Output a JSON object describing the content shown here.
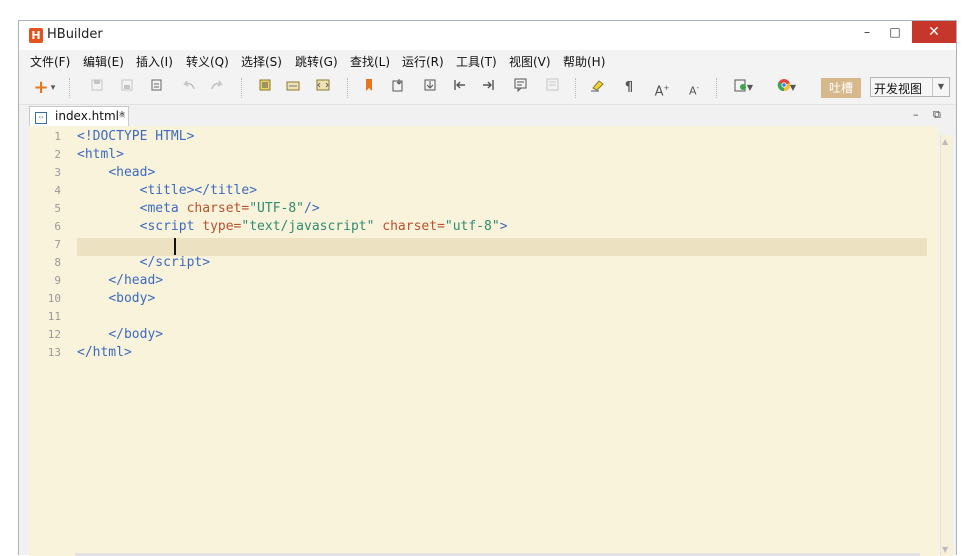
{
  "app": {
    "logo_letter": "H",
    "title": "HBuilder"
  },
  "window_controls": {
    "minimize": "–",
    "maximize": "□",
    "close": "✕"
  },
  "menu": [
    {
      "label": "文件(F)"
    },
    {
      "label": "编辑(E)"
    },
    {
      "label": "插入(I)"
    },
    {
      "label": "转义(Q)"
    },
    {
      "label": "选择(S)"
    },
    {
      "label": "跳转(G)"
    },
    {
      "label": "查找(L)"
    },
    {
      "label": "运行(R)"
    },
    {
      "label": "工具(T)"
    },
    {
      "label": "视图(V)"
    },
    {
      "label": "帮助(H)"
    }
  ],
  "toolbar": {
    "new_icon": "+",
    "new_arrow": "▾",
    "tucao_label": "吐槽",
    "view_select": "开发视图",
    "view_arrow": "▼"
  },
  "tabs": [
    {
      "label": "index.html*",
      "close": "×"
    }
  ],
  "pane_controls": {
    "minimize": "–",
    "restore": "⧉"
  },
  "editor": {
    "line_numbers": [
      "1",
      "2",
      "3",
      "4",
      "5",
      "6",
      "7",
      "8",
      "9",
      "10",
      "11",
      "12",
      "13"
    ],
    "current_line": 7
  },
  "colors": {
    "editor_bg": "#faf3dc",
    "current_line_bg": "#ece2c2",
    "tag": "#3b6bbf",
    "attr": "#b8522c",
    "value": "#2e8c70",
    "close_button": "#c7362a",
    "logo": "#e2541c"
  }
}
